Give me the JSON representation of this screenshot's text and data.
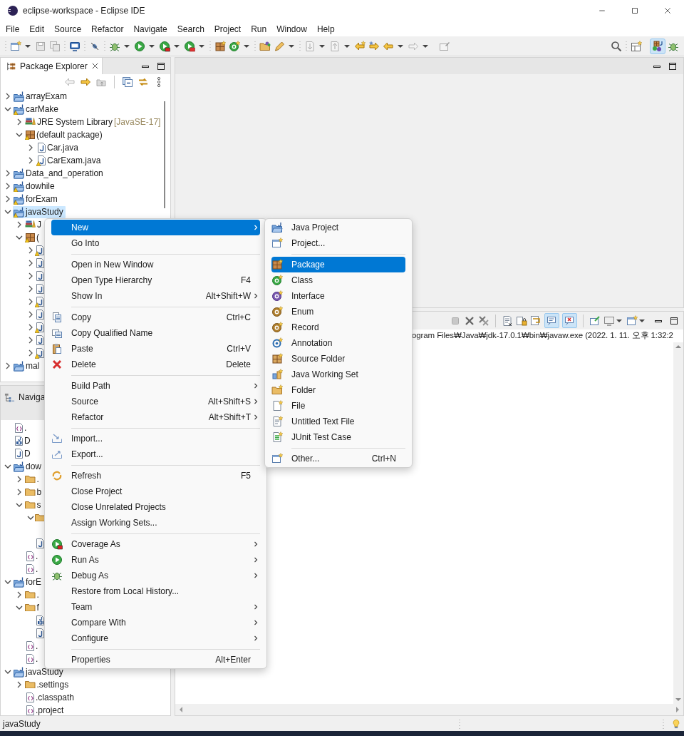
{
  "window": {
    "title": "eclipse-workspace - Eclipse IDE"
  },
  "menu_bar": [
    "File",
    "Edit",
    "Source",
    "Refactor",
    "Navigate",
    "Search",
    "Project",
    "Run",
    "Window",
    "Help"
  ],
  "perspectives": [
    {
      "selected": true
    },
    {
      "selected": false
    }
  ],
  "package_explorer": {
    "title": "Package Explorer",
    "tree": [
      {
        "label": "arrayExam",
        "kind": "project",
        "expanded": false,
        "warning": false,
        "selected": false
      },
      {
        "label": "carMake",
        "kind": "project",
        "expanded": true,
        "warning": true,
        "selected": false,
        "children": [
          {
            "label": "JRE System Library",
            "decoration": "[JavaSE-17]",
            "kind": "library",
            "expanded": false,
            "warning": false,
            "selected": false
          },
          {
            "label": "(default package)",
            "kind": "package",
            "expanded": true,
            "warning": true,
            "selected": false,
            "children": [
              {
                "label": "Car.java",
                "kind": "java",
                "expanded": false,
                "warning": false,
                "selected": false
              },
              {
                "label": "CarExam.java",
                "kind": "java",
                "expanded": false,
                "warning": true,
                "selected": false
              }
            ]
          }
        ]
      },
      {
        "label": "Data_and_operation",
        "kind": "project",
        "expanded": false,
        "warning": false,
        "selected": false
      },
      {
        "label": "dowhile",
        "kind": "project",
        "expanded": false,
        "warning": true,
        "selected": false
      },
      {
        "label": "forExam",
        "kind": "project",
        "expanded": false,
        "warning": true,
        "selected": false
      },
      {
        "label": "javaStudy",
        "kind": "project",
        "expanded": true,
        "warning": true,
        "selected": true,
        "children": [
          {
            "label": "J",
            "kind": "library",
            "expanded": false,
            "warning": false,
            "selected": false
          },
          {
            "label": "(",
            "kind": "package",
            "expanded": true,
            "warning": true,
            "selected": false,
            "children": [
              {
                "kind": "java",
                "expanded": false,
                "warning": true,
                "selected": false
              },
              {
                "kind": "java",
                "expanded": false,
                "warning": false,
                "selected": false
              },
              {
                "kind": "java",
                "expanded": false,
                "warning": false,
                "selected": false
              },
              {
                "kind": "java",
                "expanded": false,
                "warning": false,
                "selected": false
              },
              {
                "kind": "java",
                "expanded": false,
                "warning": true,
                "selected": false
              },
              {
                "kind": "java",
                "expanded": false,
                "warning": false,
                "selected": false
              },
              {
                "kind": "java",
                "expanded": false,
                "warning": true,
                "selected": false
              },
              {
                "kind": "java",
                "expanded": false,
                "warning": false,
                "selected": false
              },
              {
                "kind": "java",
                "expanded": false,
                "warning": true,
                "selected": false
              }
            ]
          }
        ]
      },
      {
        "label": "mal",
        "kind": "project",
        "expanded": false,
        "warning": false,
        "selected": false
      }
    ]
  },
  "navigator": {
    "title": "Naviga",
    "tree": [
      {
        "label": ".",
        "kind": "xml"
      },
      {
        "label": "D",
        "kind": "binary"
      },
      {
        "label": "D",
        "kind": "java"
      },
      {
        "label": "dow",
        "kind": "project",
        "expanded": true,
        "children": [
          {
            "label": ".",
            "kind": "folder",
            "expanded": false
          },
          {
            "label": "b",
            "kind": "folder",
            "expanded": false
          },
          {
            "label": "s",
            "kind": "folder",
            "expanded": true,
            "children": [
              {
                "kind": "folder",
                "expanded": true
              },
              {
                "kind": "java"
              }
            ]
          },
          {
            "label": ".",
            "kind": "xml"
          },
          {
            "label": ".",
            "kind": "xml"
          }
        ]
      },
      {
        "label": "forE",
        "kind": "project",
        "expanded": true,
        "children": [
          {
            "label": ".",
            "kind": "folder",
            "expanded": false
          },
          {
            "label": "f",
            "kind": "folder",
            "expanded": true,
            "children": [
              {
                "kind": "binary"
              },
              {
                "kind": "java"
              }
            ]
          },
          {
            "label": ".",
            "kind": "xml"
          },
          {
            "label": ".",
            "kind": "xml"
          }
        ]
      },
      {
        "label": "javaStudy",
        "kind": "project",
        "expanded": true,
        "children": [
          {
            "label": ".settings",
            "kind": "folder",
            "expanded": false
          },
          {
            "label": ".classpath",
            "kind": "xml"
          },
          {
            "label": ".project",
            "kind": "xml"
          }
        ]
      }
    ]
  },
  "console": {
    "toggles": [
      {
        "on": true
      },
      {
        "on": true
      }
    ],
    "process_line": "ogram Files₩Java₩jdk-17.0.1₩bin₩javaw.exe  (2022. 1. 11. 오후 1:32:2"
  },
  "context_menu": {
    "groups": [
      [
        {
          "label": "New",
          "submenu": true,
          "selected": true
        },
        {
          "label": "Go Into",
          "submenu": false,
          "selected": false
        }
      ],
      [
        {
          "label": "Open in New Window",
          "submenu": false,
          "selected": false
        },
        {
          "label": "Open Type Hierarchy",
          "shortcut": "F4",
          "submenu": false,
          "selected": false
        },
        {
          "label": "Show In",
          "shortcut": "Alt+Shift+W",
          "submenu": true,
          "selected": false
        }
      ],
      [
        {
          "label": "Copy",
          "shortcut": "Ctrl+C",
          "submenu": false,
          "selected": false
        },
        {
          "label": "Copy Qualified Name",
          "submenu": false,
          "selected": false
        },
        {
          "label": "Paste",
          "shortcut": "Ctrl+V",
          "submenu": false,
          "selected": false
        },
        {
          "label": "Delete",
          "shortcut": "Delete",
          "submenu": false,
          "selected": false
        }
      ],
      [
        {
          "label": "Build Path",
          "submenu": true,
          "selected": false
        },
        {
          "label": "Source",
          "shortcut": "Alt+Shift+S",
          "submenu": true,
          "selected": false
        },
        {
          "label": "Refactor",
          "shortcut": "Alt+Shift+T",
          "submenu": true,
          "selected": false
        }
      ],
      [
        {
          "label": "Import...",
          "submenu": false,
          "selected": false
        },
        {
          "label": "Export...",
          "submenu": false,
          "selected": false
        }
      ],
      [
        {
          "label": "Refresh",
          "shortcut": "F5",
          "submenu": false,
          "selected": false
        },
        {
          "label": "Close Project",
          "submenu": false,
          "selected": false
        },
        {
          "label": "Close Unrelated Projects",
          "submenu": false,
          "selected": false
        },
        {
          "label": "Assign Working Sets...",
          "submenu": false,
          "selected": false
        }
      ],
      [
        {
          "label": "Coverage As",
          "submenu": true,
          "selected": false
        },
        {
          "label": "Run As",
          "submenu": true,
          "selected": false
        },
        {
          "label": "Debug As",
          "submenu": true,
          "selected": false
        },
        {
          "label": "Restore from Local History...",
          "submenu": false,
          "selected": false
        },
        {
          "label": "Team",
          "submenu": true,
          "selected": false
        },
        {
          "label": "Compare With",
          "submenu": true,
          "selected": false
        },
        {
          "label": "Configure",
          "submenu": true,
          "selected": false
        }
      ],
      [
        {
          "label": "Properties",
          "shortcut": "Alt+Enter",
          "submenu": false,
          "selected": false
        }
      ]
    ]
  },
  "new_submenu": {
    "groups": [
      [
        {
          "label": "Java Project",
          "selected": false
        },
        {
          "label": "Project...",
          "selected": false
        }
      ],
      [
        {
          "label": "Package",
          "selected": true
        },
        {
          "label": "Class",
          "selected": false
        },
        {
          "label": "Interface",
          "selected": false
        },
        {
          "label": "Enum",
          "selected": false
        },
        {
          "label": "Record",
          "selected": false
        },
        {
          "label": "Annotation",
          "selected": false
        },
        {
          "label": "Source Folder",
          "selected": false
        },
        {
          "label": "Java Working Set",
          "selected": false
        },
        {
          "label": "Folder",
          "selected": false
        },
        {
          "label": "File",
          "selected": false
        },
        {
          "label": "Untitled Text File",
          "selected": false
        },
        {
          "label": "JUnit Test Case",
          "selected": false
        }
      ],
      [
        {
          "label": "Other...",
          "shortcut": "Ctrl+N",
          "selected": false
        }
      ]
    ]
  },
  "status_bar": {
    "text": "javaStudy"
  }
}
